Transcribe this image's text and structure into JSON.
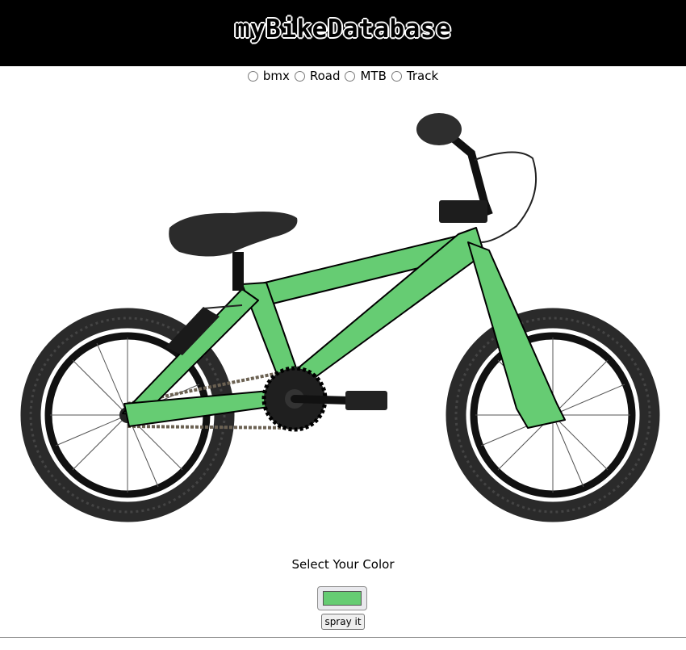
{
  "header": {
    "title": "myBikeDatabase"
  },
  "bike_types": [
    {
      "label": "bmx",
      "selected": false
    },
    {
      "label": "Road",
      "selected": false
    },
    {
      "label": "MTB",
      "selected": false
    },
    {
      "label": "Track",
      "selected": false
    }
  ],
  "bike_image": {
    "frame_color": "#66cc73",
    "tire_color": "#2a2a2a"
  },
  "color_section": {
    "label": "Select Your Color",
    "current_color": "#66cc73",
    "button_label": "spray it"
  }
}
